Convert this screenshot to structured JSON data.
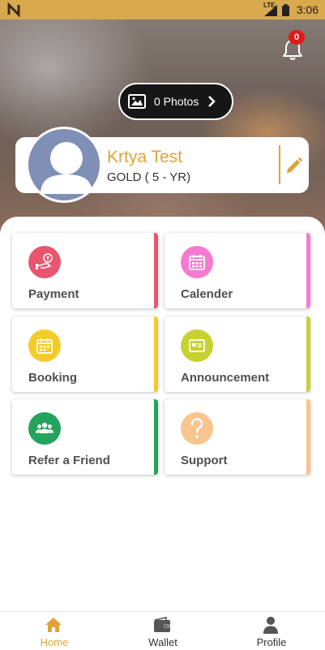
{
  "status_bar": {
    "network": "LTE",
    "time": "3:06"
  },
  "notifications": {
    "count": "0"
  },
  "photos": {
    "label": "0 Photos"
  },
  "profile": {
    "name": "Krtya Test",
    "plan": "GOLD ( 5 - YR)"
  },
  "tiles": [
    {
      "label": "Payment",
      "icon": "payment-icon",
      "color": "#e8566d"
    },
    {
      "label": "Calender",
      "icon": "calendar-icon",
      "color": "#f57ad2"
    },
    {
      "label": "Booking",
      "icon": "booking-icon",
      "color": "#f4cc27"
    },
    {
      "label": "Announcement",
      "icon": "announcement-icon",
      "color": "#c9d132"
    },
    {
      "label": "Refer a Friend",
      "icon": "refer-friend-icon",
      "color": "#24a35c"
    },
    {
      "label": "Support",
      "icon": "support-icon",
      "color": "#f7c58d"
    }
  ],
  "bottom_nav": [
    {
      "label": "Home",
      "icon": "home-icon",
      "active": true
    },
    {
      "label": "Wallet",
      "icon": "wallet-icon",
      "active": false
    },
    {
      "label": "Profile",
      "icon": "profile-icon",
      "active": false
    }
  ],
  "colors": {
    "accent": "#e0a338",
    "status_bar": "#d9a94e",
    "badge": "#e01919",
    "nav_inactive": "#333333"
  }
}
